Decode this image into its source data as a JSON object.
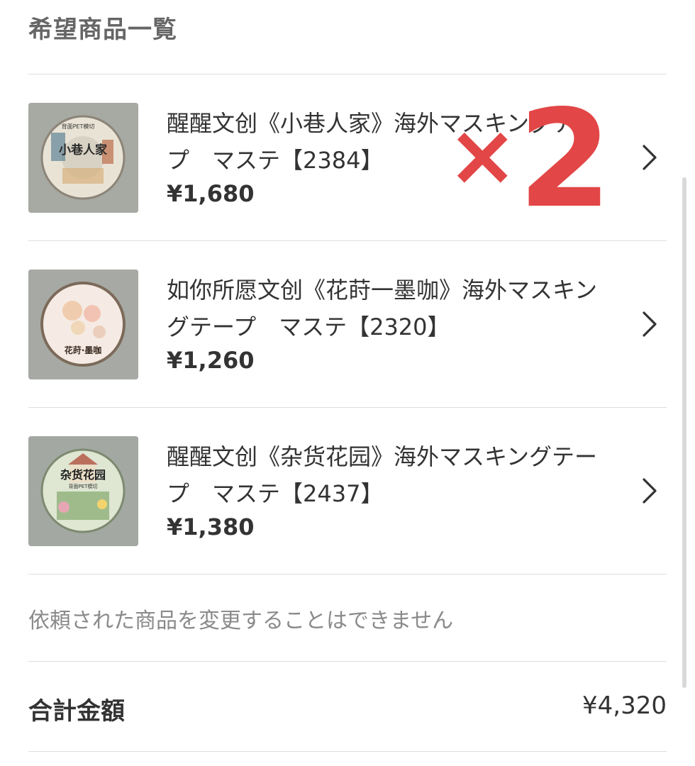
{
  "section": {
    "title": "希望商品一覧"
  },
  "items": [
    {
      "title": "醒醒文创《小巷人家》海外マスキングテープ　マステ【2384】",
      "price": "¥1,680",
      "thumb_label": "小巷人家",
      "thumb_sub": "背面PET模切"
    },
    {
      "title": "如你所愿文创《花莳一墨咖》海外マスキングテープ　マステ【2320】",
      "price": "¥1,260",
      "thumb_label": "花莳·墨咖"
    },
    {
      "title": "醒醒文创《杂货花园》海外マスキングテープ　マステ【2437】",
      "price": "¥1,380",
      "thumb_label": "杂货花园",
      "thumb_sub": "背面PET模切"
    }
  ],
  "overlay": {
    "x": "×",
    "count": "2"
  },
  "notice": "依頼された商品を変更することはできません",
  "total": {
    "label": "合計金額",
    "value": "¥4,320"
  },
  "colors": {
    "accent_red": "#e24646",
    "divider": "#dedede",
    "muted_text": "#8a8a8a"
  },
  "icons": {
    "chevron": "chevron-right-icon"
  }
}
